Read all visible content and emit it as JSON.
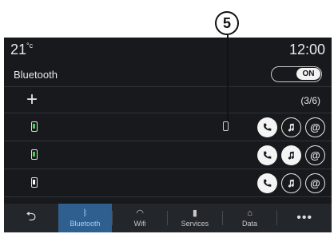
{
  "callout": {
    "number": "5"
  },
  "status": {
    "temperature": "21",
    "temp_unit": "°c",
    "time": "12:00"
  },
  "bluetooth": {
    "label": "Bluetooth",
    "toggle_label": "ON"
  },
  "add_row": {
    "plus": "+",
    "count": "(3/6)"
  },
  "devices": [
    {
      "icon": "phone-green-icon",
      "icons": [
        "phone",
        "music",
        "at"
      ]
    },
    {
      "icon": "phone-green-icon",
      "icons": [
        "phone",
        "music",
        "at"
      ]
    },
    {
      "icon": "phone-white-icon",
      "icons": [
        "phone",
        "music",
        "at"
      ]
    }
  ],
  "nav": {
    "back": "⮌",
    "items": [
      {
        "label": "Bluetooth",
        "icon": "bluetooth-icon",
        "active": true
      },
      {
        "label": "Wifi",
        "icon": "wifi-icon"
      },
      {
        "label": "Services",
        "icon": "services-icon"
      },
      {
        "label": "Data",
        "icon": "data-icon"
      }
    ],
    "more": "•••"
  },
  "colors": {
    "screen_bg": "#17191d",
    "active_tab": "#2f5f8f",
    "accent_text": "#9fd0ff"
  }
}
